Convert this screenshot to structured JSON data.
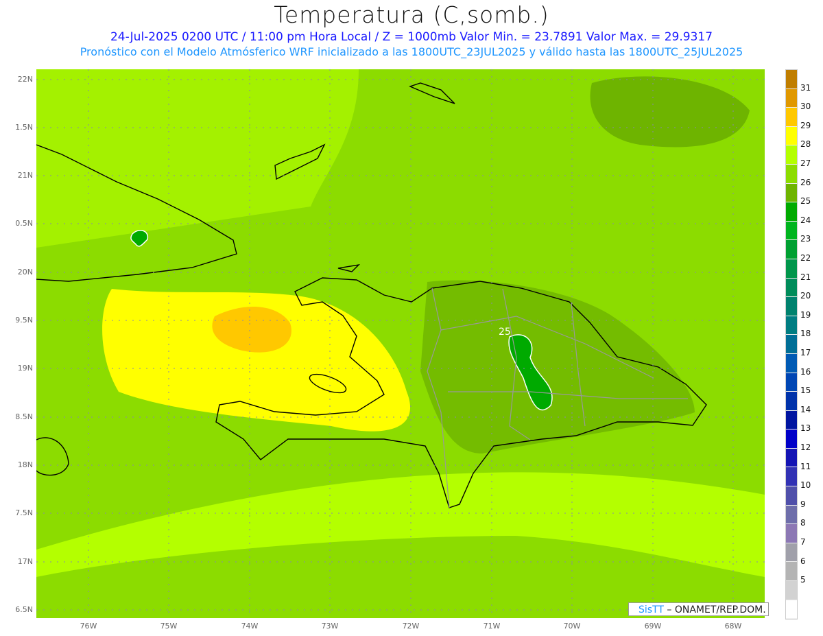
{
  "header": {
    "title": "Temperatura (C,somb.)",
    "line1": "24-Jul-2025 0200 UTC / 11:00 pm Hora Local / Z = 1000mb   Valor Min. = 23.7891   Valor Max. = 29.9317",
    "line2": "Pronóstico con el Modelo Atmósferico WRF inicializado a las 1800UTC_23JUL2025 y válido hasta las  1800UTC_25JUL2025"
  },
  "axes": {
    "lat_labels": [
      "22N",
      "1.5N",
      "21N",
      "0.5N",
      "20N",
      "9.5N",
      "19N",
      "8.5N",
      "18N",
      "7.5N",
      "17N",
      "6.5N"
    ],
    "lon_labels": [
      "76W",
      "75W",
      "74W",
      "73W",
      "72W",
      "71W",
      "70W",
      "69W",
      "68W"
    ]
  },
  "contour_label": "25",
  "colorbar": {
    "labels": [
      "31",
      "30",
      "29",
      "28",
      "27",
      "26",
      "25",
      "24",
      "23",
      "22",
      "21",
      "20",
      "19",
      "18",
      "17",
      "16",
      "15",
      "14",
      "13",
      "12",
      "11",
      "10",
      "9",
      "8",
      "7",
      "6",
      "5"
    ],
    "colors": [
      "#c07e00",
      "#e09800",
      "#ffc800",
      "#ffff00",
      "#b4ff00",
      "#8cdc00",
      "#6eb400",
      "#00aa00",
      "#00b41e",
      "#00a032",
      "#00964b",
      "#008c5a",
      "#00826e",
      "#007d82",
      "#006e96",
      "#005ab4",
      "#0046b4",
      "#0032aa",
      "#0014a0",
      "#0000c8",
      "#1414b4",
      "#3232b4",
      "#5050aa",
      "#6e6eaa",
      "#8c78b4",
      "#a0a0aa",
      "#b4b4b4",
      "#d2d2d2",
      "#ffffff"
    ]
  },
  "credit": {
    "brand": "SisTT",
    "text": " – ONAMET/REP.DOM."
  }
}
